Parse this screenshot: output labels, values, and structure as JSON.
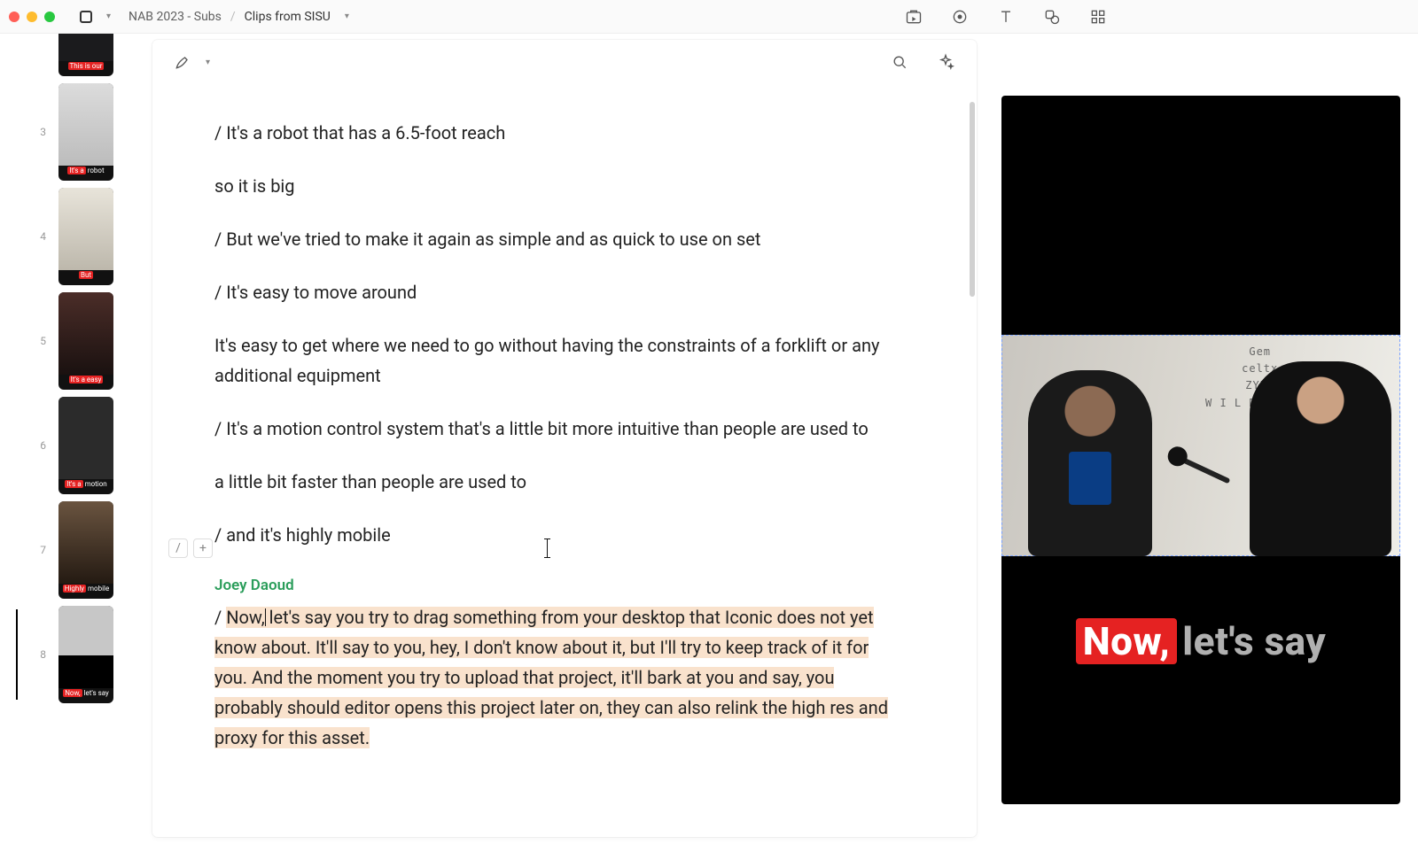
{
  "breadcrumb": {
    "project": "NAB 2023 - Subs",
    "clip": "Clips from SISU"
  },
  "thumbnails": [
    {
      "idx": "",
      "caption_hl": "This is our",
      "caption_rest": ""
    },
    {
      "idx": "3",
      "caption_hl": "It's a",
      "caption_rest": "robot"
    },
    {
      "idx": "4",
      "caption_hl": "But",
      "caption_rest": ""
    },
    {
      "idx": "5",
      "caption_hl": "It's a easy",
      "caption_rest": ""
    },
    {
      "idx": "6",
      "caption_hl": "It's a",
      "caption_rest": "motion"
    },
    {
      "idx": "7",
      "caption_hl": "Highly",
      "caption_rest": "mobile"
    },
    {
      "idx": "8",
      "caption_hl": "Now,",
      "caption_rest": "let's say"
    }
  ],
  "transcript": {
    "l1": "/ It's a robot that has a 6.5-foot reach",
    "l2": "so it is big",
    "l3": "/ But we've tried to make it again as simple and as quick to use on set",
    "l4": "/ It's easy to move around",
    "l5": "It's easy to get where we need to go without having the constraints of a forklift or any additional equipment",
    "l6": "/ It's a motion control system that's a little bit more intuitive than people are used to",
    "l7": "a little bit faster than people are used to",
    "l8": "/ and it's highly mobile",
    "speaker": "Joey Daoud",
    "hl_prefix": "/ ",
    "hl_first": "Now,",
    "hl_rest": " let's say you try to drag something from your desktop that Iconic does not yet know about. It'll say to you, hey, I don't know about it, but I'll try to keep track of it for you. And the moment you try to upload that project, it'll bark at you and say, you probably should editor opens this project later on, they can also relink the high res and proxy for this asset."
  },
  "gutter": {
    "slash": "/",
    "plus": "+"
  },
  "preview": {
    "brands": {
      "b1": "Gem",
      "b2": "celtx",
      "b3": "ZYPE",
      "b4": "W I L D M O K A"
    },
    "subtitle_hl": "Now,",
    "subtitle_rest": "let's say"
  }
}
